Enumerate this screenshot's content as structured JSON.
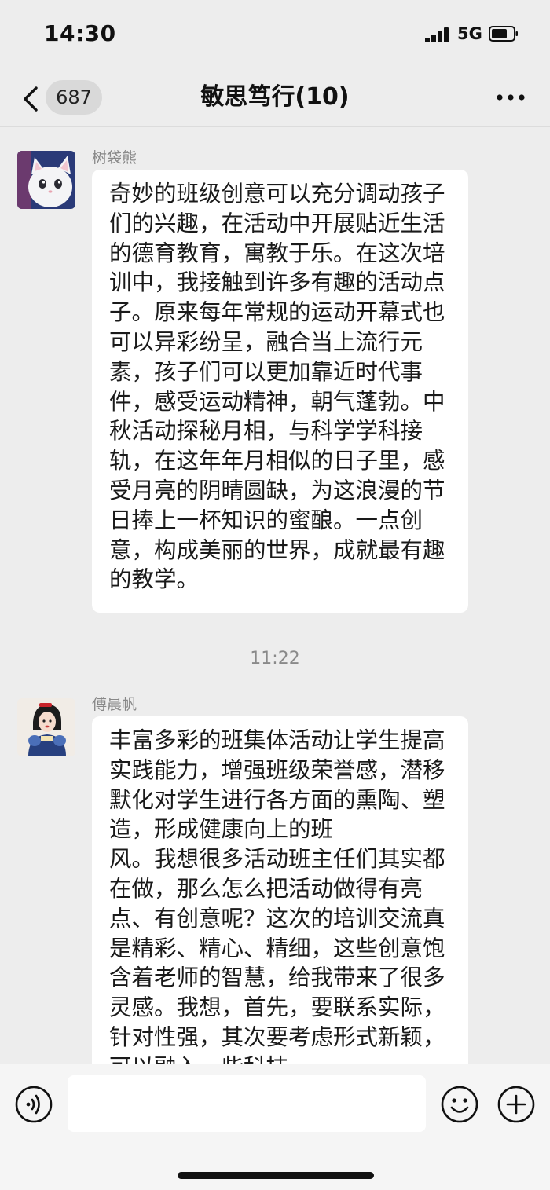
{
  "status_bar": {
    "time": "14:30",
    "network": "5G"
  },
  "nav": {
    "unread_count": "687",
    "title": "敏思笃行(10)"
  },
  "messages": [
    {
      "sender": "树袋熊",
      "text": "奇妙的班级创意可以充分调动孩子们的兴趣，在活动中开展贴近生活的德育教育，寓教于乐。在这次培训中，我接触到许多有趣的活动点子。原来每年常规的运动开幕式也可以异彩纷呈，融合当上流行元素，孩子们可以更加靠近时代事件，感受运动精神，朝气蓬勃。中秋活动探秘月相，与科学学科接轨，在这年年月相似的日子里，感受月亮的阴晴圆缺，为这浪漫的节日捧上一杯知识的蜜酿。一点创意，构成美丽的世界，成就最有趣的教学。"
    },
    {
      "sender": "傅晨帆",
      "text": "丰富多彩的班集体活动让学生提高实践能力，增强班级荣誉感，潜移默化对学生进行各方面的熏陶、塑造，形成健康向上的班\n风。我想很多活动班主任们其实都在做，那么怎么把活动做得有亮点、有创意呢？这次的培训交流真是精彩、精心、精细，这些创意饱含着老师的智慧，给我带来了很多灵感。我想，首先，要联系实际，针对性强，其次要考虑形式新颖，可以融入一些科技"
    }
  ],
  "timestamp": "11:22",
  "input": {
    "value": ""
  }
}
